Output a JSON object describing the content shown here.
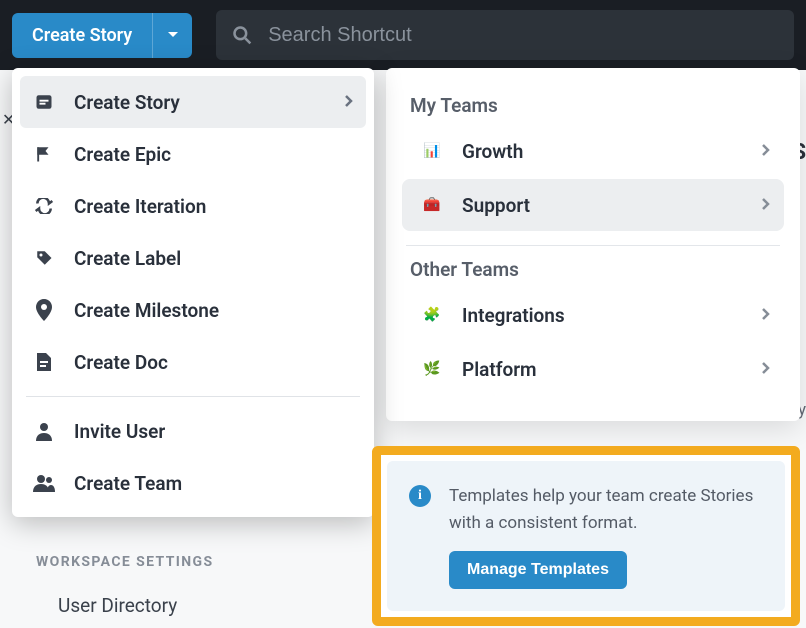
{
  "topbar": {
    "create_label": "Create Story",
    "search_placeholder": "Search Shortcut"
  },
  "create_menu": {
    "items": [
      {
        "label": "Create Story"
      },
      {
        "label": "Create Epic"
      },
      {
        "label": "Create Iteration"
      },
      {
        "label": "Create Label"
      },
      {
        "label": "Create Milestone"
      },
      {
        "label": "Create Doc"
      }
    ],
    "secondary": [
      {
        "label": "Invite User"
      },
      {
        "label": "Create Team"
      }
    ]
  },
  "teams_panel": {
    "my_teams_heading": "My Teams",
    "my_teams": [
      {
        "label": "Growth",
        "icon": "📊"
      },
      {
        "label": "Support",
        "icon": "🧰"
      }
    ],
    "other_teams_heading": "Other Teams",
    "other_teams": [
      {
        "label": "Integrations",
        "icon": "🧩"
      },
      {
        "label": "Platform",
        "icon": "🌿"
      }
    ]
  },
  "templates": {
    "text": "Templates help your team create Stories with a consistent format.",
    "button": "Manage Templates"
  },
  "workspace": {
    "heading": "WORKSPACE SETTINGS",
    "item": "User Directory"
  }
}
